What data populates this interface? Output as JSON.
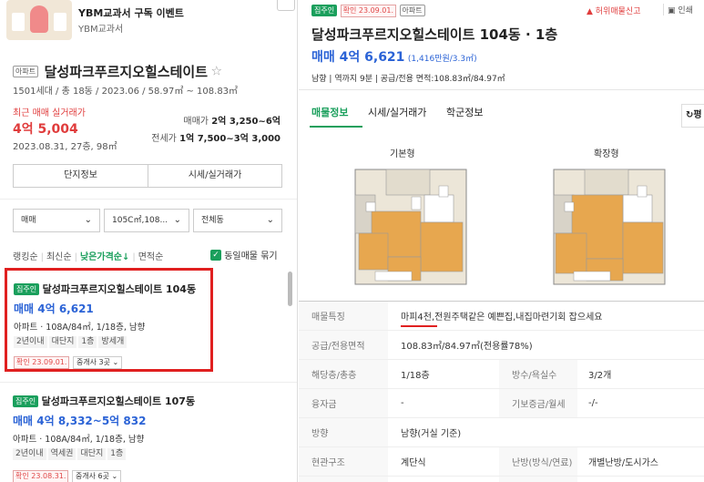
{
  "banner": {
    "title": "YBM교과서 구독 이벤트",
    "subtitle": "YBM교과서"
  },
  "complex": {
    "type_badge": "아파트",
    "name": "달성파크푸르지오힐스테이트",
    "star": "☆",
    "info": "1501세대 / 총 18동 / 2023.06 / 58.97㎡ ~ 108.83㎡",
    "recent_label": "최근 매매 실거래가",
    "recent_price": "4억 5,004",
    "recent_date": "2023.08.31, 27층, 98㎡",
    "sale_label": "매매가",
    "sale_range": "2억 3,250~6억",
    "jeonse_label": "전세가",
    "jeonse_range": "1억 7,500~3억 3,000",
    "btn_info": "단지정보",
    "btn_price": "시세/실거래가"
  },
  "filters": {
    "deal": "매매",
    "area": "105C㎡,108...",
    "dong": "전체동"
  },
  "sort": {
    "items": [
      "랭킹순",
      "최신순",
      "낮은가격순↓",
      "면적순"
    ],
    "same_label": "동일매물 묶기"
  },
  "listings": [
    {
      "badge": "집주인",
      "title": "달성파크푸르지오힐스테이트 104동",
      "price": "매매 4억 6,621",
      "spec": "아파트 · 108A/84㎡, 1/18층, 남향",
      "tags": [
        "2년이내",
        "대단지",
        "1층",
        "방세개"
      ],
      "confirm": "확인 23.09.01.",
      "agent": "중개사 3곳"
    },
    {
      "badge": "집주인",
      "title": "달성파크푸르지오힐스테이트 107동",
      "price": "매매 4억 8,332~5억 832",
      "spec": "아파트 · 108A/84㎡, 1/18층, 남향",
      "tags": [
        "2년이내",
        "역세권",
        "대단지",
        "1층"
      ],
      "confirm": "확인 23.08.31.",
      "agent": "중개사 6곳"
    }
  ],
  "detail": {
    "badge": "집주인",
    "confirm": "확인 23.09.01.",
    "type": "아파트",
    "report": "허위매물신고",
    "print": "인쇄",
    "title": "달성파크푸르지오힐스테이트 104동 · 1층",
    "price": "매매 4억 6,621",
    "per_area": "(1,416만원/3.3㎡)",
    "meta": "남향 | 역까지 9분 | 공급/전용 면적:108.83㎡/84.97㎡",
    "tabs": [
      "매물정보",
      "시세/실거래가",
      "학군정보"
    ],
    "tab_right": "평",
    "fp_labels": [
      "기본형",
      "확장형"
    ],
    "rows": [
      {
        "k": "매물특징",
        "v": "마피4천,전원주택같은 예쁜집,내집마련기회 잡으세요"
      },
      {
        "k": "공급/전용면적",
        "v": "108.83㎡/84.97㎡(전용률78%)"
      },
      {
        "k": "해당층/총층",
        "v": "1/18층",
        "k2": "방수/욕실수",
        "v2": "3/2개"
      },
      {
        "k": "융자금",
        "v": "-",
        "k2": "기보증금/월세",
        "v2": "-/-"
      },
      {
        "k": "방향",
        "v": "남향(거실 기준)"
      },
      {
        "k": "현관구조",
        "v": "계단식",
        "k2": "난방(방식/연료)",
        "v2": "개별난방/도시가스"
      }
    ]
  },
  "colors": {
    "accent_blue": "#2b63d6",
    "red": "#e03c3c",
    "green": "#1a9f5c",
    "highlight_border": "#e02020"
  }
}
